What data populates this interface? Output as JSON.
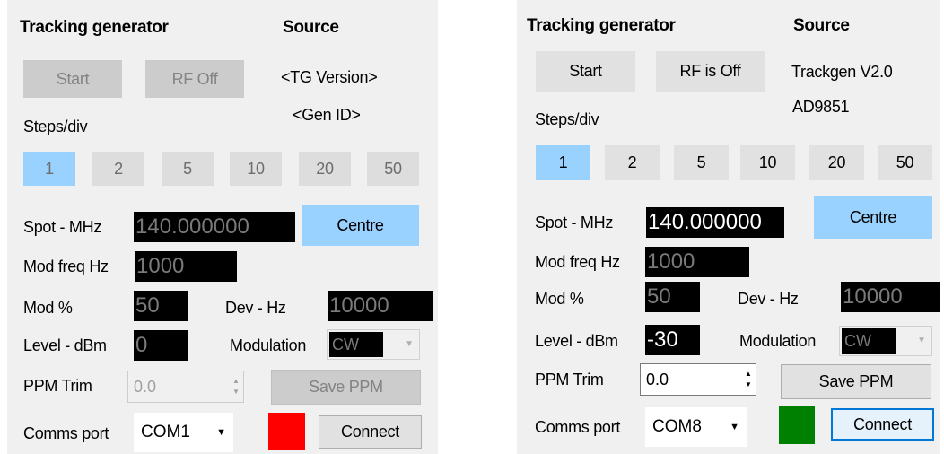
{
  "left": {
    "heading_tg": "Tracking generator",
    "heading_source": "Source",
    "start_label": "Start",
    "rf_label": "RF Off",
    "tg_version": "<TG Version>",
    "gen_id": "<Gen ID>",
    "steps_label": "Steps/div",
    "steps": [
      "1",
      "2",
      "5",
      "10",
      "20",
      "50"
    ],
    "selected_step": "1",
    "spot_label": "Spot - MHz",
    "spot_value": "140.000000",
    "centre_label": "Centre",
    "modfreq_label": "Mod freq Hz",
    "modfreq_value": "1000",
    "mod_label": "Mod %",
    "mod_value": "50",
    "dev_label": "Dev - Hz",
    "dev_value": "10000",
    "level_label": "Level - dBm",
    "level_value": "0",
    "modulation_label": "Modulation",
    "modulation_value": "CW",
    "ppm_label": "PPM Trim",
    "ppm_value": "0.0",
    "save_ppm_label": "Save PPM",
    "comms_label": "Comms port",
    "comms_value": "COM1",
    "connect_label": "Connect",
    "status_color": "#ff0000"
  },
  "right": {
    "heading_tg": "Tracking generator",
    "heading_source": "Source",
    "start_label": "Start",
    "rf_label": "RF is Off",
    "tg_version": "Trackgen V2.0",
    "gen_id": "AD9851",
    "steps_label": "Steps/div",
    "steps": [
      "1",
      "2",
      "5",
      "10",
      "20",
      "50"
    ],
    "selected_step": "1",
    "spot_label": "Spot - MHz",
    "spot_value": "140.000000",
    "centre_label": "Centre",
    "modfreq_label": "Mod freq Hz",
    "modfreq_value": "1000",
    "mod_label": "Mod %",
    "mod_value": "50",
    "dev_label": "Dev - Hz",
    "dev_value": "10000",
    "level_label": "Level - dBm",
    "level_value": "-30",
    "modulation_label": "Modulation",
    "modulation_value": "CW",
    "ppm_label": "PPM Trim",
    "ppm_value": "0.0",
    "save_ppm_label": "Save PPM",
    "comms_label": "Comms port",
    "comms_value": "COM8",
    "connect_label": "Connect",
    "status_color": "#008000"
  }
}
